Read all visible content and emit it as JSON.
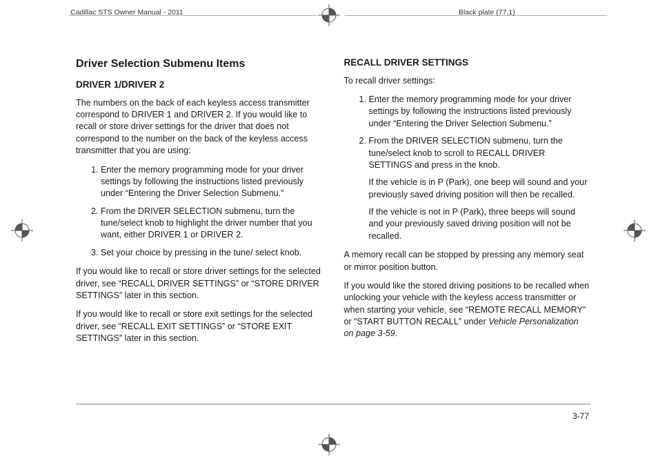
{
  "header": {
    "left": "Cadillac STS Owner Manual - 2011",
    "right": "Black plate (77,1)"
  },
  "left_col": {
    "h2": "Driver Selection Submenu Items",
    "h3": "DRIVER 1/DRIVER 2",
    "intro": "The numbers on the back of each keyless access transmitter correspond to DRIVER 1 and DRIVER 2. If you would like to recall or store driver settings for the driver that does not correspond to the number on the back of the keyless access transmitter that you are using:",
    "steps": [
      "Enter the memory programming mode for your driver settings by following the instructions listed previously under “Entering the Driver Selection Submenu.”",
      "From the DRIVER SELECTION submenu, turn the tune/select knob to highlight the driver number that you want, either DRIVER 1 or DRIVER 2.",
      "Set your choice by pressing in the tune/ select knob."
    ],
    "p_after_1": "If you would like to recall or store driver settings for the selected driver, see “RECALL DRIVER SETTINGS” or “STORE DRIVER SETTINGS” later in this section.",
    "p_after_2": "If you would like to recall or store exit settings for the selected driver, see “RECALL EXIT SETTINGS” or “STORE EXIT SETTINGS” later in this section."
  },
  "right_col": {
    "h3": "RECALL DRIVER SETTINGS",
    "intro": "To recall driver settings:",
    "step1": "Enter the memory programming mode for your driver settings by following the instructions listed previously under “Entering the Driver Selection Submenu.”",
    "step2_a": "From the DRIVER SELECTION submenu, turn the tune/select knob to scroll to RECALL DRIVER SETTINGS and press in the knob.",
    "step2_b": "If the vehicle is in P (Park), one beep will sound and your previously saved driving position will then be recalled.",
    "step2_c": "If the vehicle is not in P (Park), three beeps will sound and your previously saved driving position will not be recalled.",
    "p_after_1": "A memory recall can be stopped by pressing any memory seat or mirror position button.",
    "p_after_2_pre": "If you would like the stored driving positions to be recalled when unlocking your vehicle with the keyless access transmitter or when starting your vehicle, see “REMOTE RECALL MEMORY” or “START BUTTON RECALL” under ",
    "p_after_2_ital": "Vehicle Personalization on page 3-59",
    "p_after_2_post": "."
  },
  "page_number": "3-77"
}
